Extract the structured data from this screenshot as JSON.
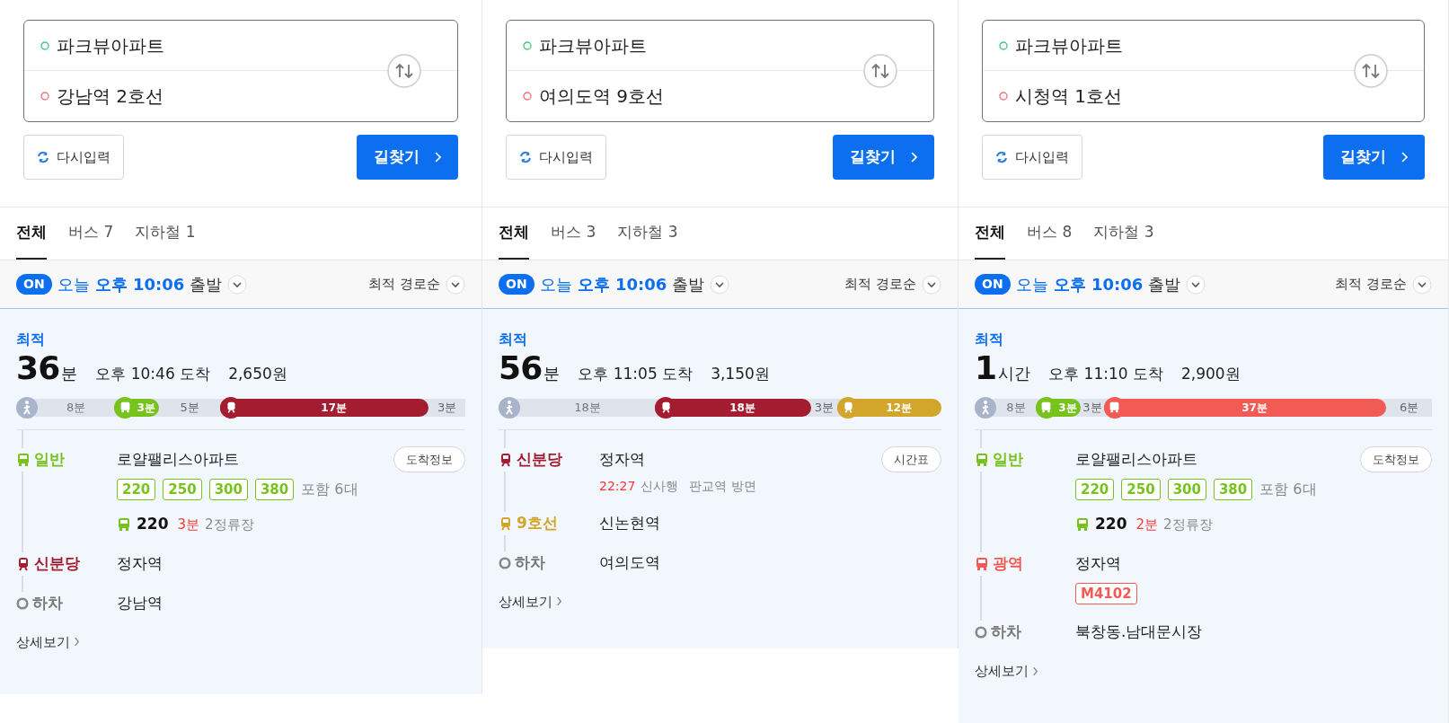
{
  "panels": [
    {
      "origin": "파크뷰아파트",
      "destination": "강남역 2호선",
      "reset_button": "다시입력",
      "search_button": "길찾기",
      "tabs": [
        {
          "label": "전체",
          "selected": true
        },
        {
          "label": "버스 7",
          "selected": false
        },
        {
          "label": "지하철 1",
          "selected": false
        }
      ],
      "departure": {
        "badge": "ON",
        "day": "오늘",
        "time": "오후 10:06",
        "suffix": "출발",
        "sort": "최적 경로순"
      },
      "summary": {
        "tag": "최적",
        "duration": "36",
        "unit": "분",
        "arrival": "오후 10:46 도착",
        "fare": "2,650원"
      },
      "segments": [
        {
          "kind": "walk",
          "label": "8분"
        },
        {
          "kind": "bus",
          "label": "3분",
          "color": "#78c21e"
        },
        {
          "kind": "gap",
          "label": "5분"
        },
        {
          "kind": "subway",
          "label": "17분",
          "color": "#a31c30"
        },
        {
          "kind": "gap",
          "label": "3분"
        }
      ],
      "steps": [
        {
          "kind": "bus",
          "label": "일반",
          "color": "#78c21e",
          "station": "로얄팰리스아파트",
          "action": "도착정보",
          "chips": [
            "220",
            "250",
            "300",
            "380"
          ],
          "chips_note": "포함 6대",
          "next_bus": {
            "number": "220",
            "eta": "3분",
            "stops": "2정류장"
          }
        },
        {
          "kind": "subway",
          "label": "신분당",
          "color": "#a31c30",
          "station": "정자역"
        },
        {
          "kind": "alight",
          "label": "하차",
          "station": "강남역"
        }
      ],
      "details": "상세보기"
    },
    {
      "origin": "파크뷰아파트",
      "destination": "여의도역 9호선",
      "reset_button": "다시입력",
      "search_button": "길찾기",
      "tabs": [
        {
          "label": "전체",
          "selected": true
        },
        {
          "label": "버스 3",
          "selected": false
        },
        {
          "label": "지하철 3",
          "selected": false
        }
      ],
      "departure": {
        "badge": "ON",
        "day": "오늘",
        "time": "오후 10:06",
        "suffix": "출발",
        "sort": "최적 경로순"
      },
      "summary": {
        "tag": "최적",
        "duration": "56",
        "unit": "분",
        "arrival": "오후 11:05 도착",
        "fare": "3,150원"
      },
      "segments": [
        {
          "kind": "walk",
          "label": "18분"
        },
        {
          "kind": "subway",
          "label": "18분",
          "color": "#a31c30"
        },
        {
          "kind": "gap",
          "label": "3분"
        },
        {
          "kind": "subway",
          "label": "12분",
          "color": "#d2a52b"
        }
      ],
      "steps": [
        {
          "kind": "subway",
          "label": "신분당",
          "color": "#a31c30",
          "station": "정자역",
          "action": "시간표",
          "timetable": {
            "time": "22:27",
            "destination": "신사행",
            "direction": "판교역 방면"
          }
        },
        {
          "kind": "subway",
          "label": "9호선",
          "color": "#d2a52b",
          "station": "신논현역"
        },
        {
          "kind": "alight",
          "label": "하차",
          "station": "여의도역"
        }
      ],
      "details": "상세보기"
    },
    {
      "origin": "파크뷰아파트",
      "destination": "시청역 1호선",
      "reset_button": "다시입력",
      "search_button": "길찾기",
      "tabs": [
        {
          "label": "전체",
          "selected": true
        },
        {
          "label": "버스 8",
          "selected": false
        },
        {
          "label": "지하철 3",
          "selected": false
        }
      ],
      "departure": {
        "badge": "ON",
        "day": "오늘",
        "time": "오후 10:06",
        "suffix": "출발",
        "sort": "최적 경로순"
      },
      "summary": {
        "tag": "최적",
        "duration": "1",
        "unit": "시간",
        "arrival": "오후 11:10 도착",
        "fare": "2,900원"
      },
      "segments": [
        {
          "kind": "walk",
          "label": "8분"
        },
        {
          "kind": "bus",
          "label": "3분",
          "color": "#78c21e"
        },
        {
          "kind": "gap",
          "label": "3분"
        },
        {
          "kind": "bus",
          "label": "37분",
          "color": "#f25a55"
        },
        {
          "kind": "gap",
          "label": "6분"
        }
      ],
      "steps": [
        {
          "kind": "bus",
          "label": "일반",
          "color": "#78c21e",
          "station": "로얄팰리스아파트",
          "action": "도착정보",
          "chips": [
            "220",
            "250",
            "300",
            "380"
          ],
          "chips_note": "포함 6대",
          "next_bus": {
            "number": "220",
            "eta": "2분",
            "stops": "2정류장"
          }
        },
        {
          "kind": "bus",
          "label": "광역",
          "color": "#f25a55",
          "station": "정자역",
          "chips": [
            "M4102"
          ]
        },
        {
          "kind": "alight",
          "label": "하차",
          "station": "북창동.남대문시장"
        }
      ],
      "details": "상세보기"
    }
  ]
}
